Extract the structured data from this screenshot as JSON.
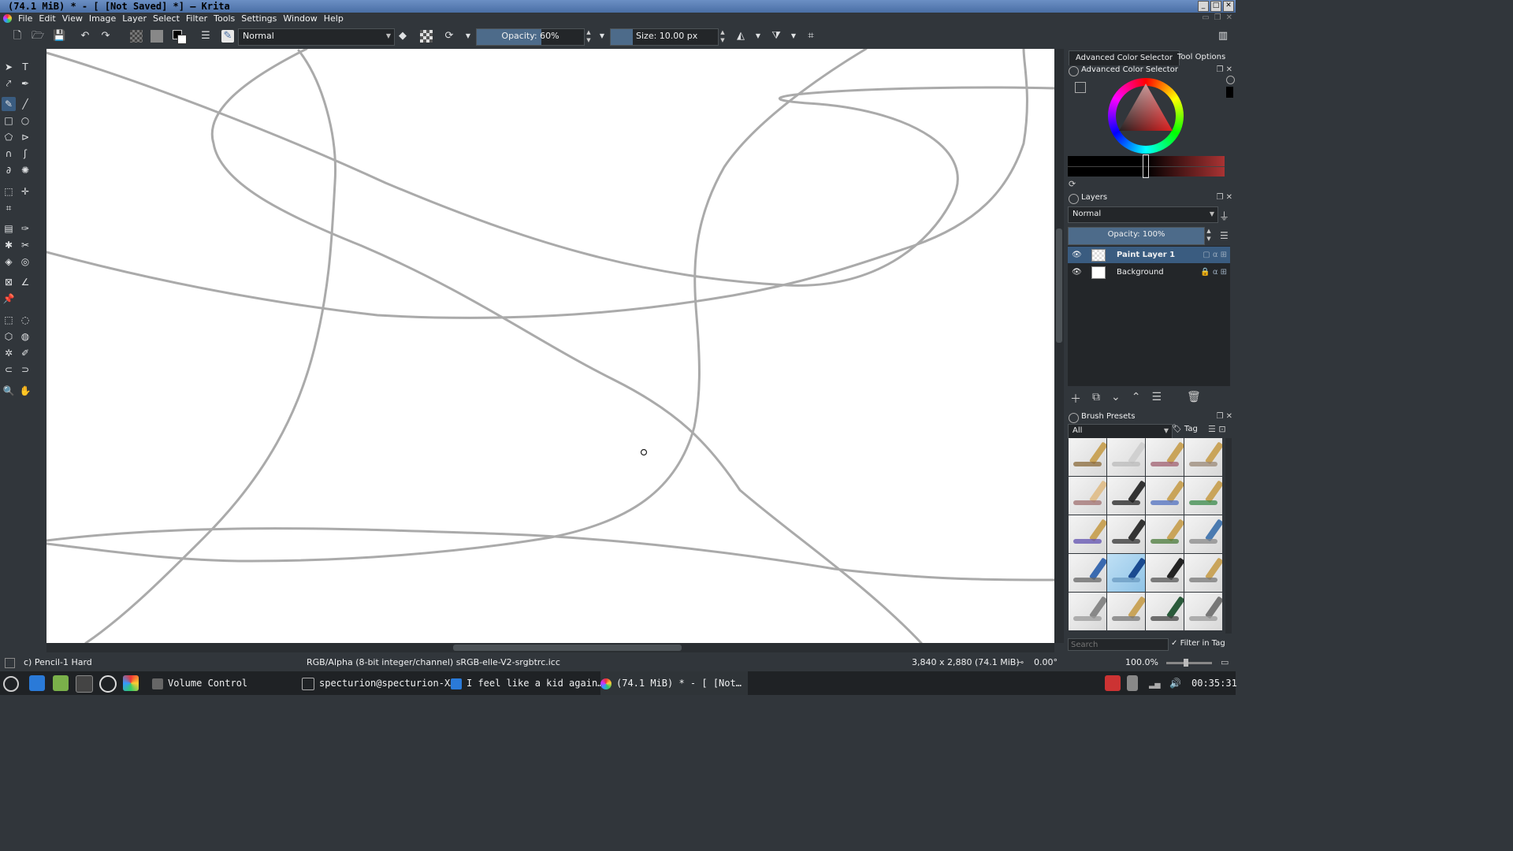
{
  "window": {
    "title": "(74.1 MiB)  * - [ [Not Saved]  *] – Krita",
    "controls": [
      "_",
      "□",
      "✕"
    ]
  },
  "menubar": {
    "items": [
      "File",
      "Edit",
      "View",
      "Image",
      "Layer",
      "Select",
      "Filter",
      "Tools",
      "Settings",
      "Window",
      "Help"
    ]
  },
  "toolbar": {
    "blend_mode": "Normal",
    "opacity_label": "Opacity: 60%",
    "opacity_value": 0.6,
    "size_label": "Size: 10.00 px",
    "colors": {
      "foreground": "#000000",
      "background": "#ffffff",
      "accent": "#4d6b8a"
    }
  },
  "toolbox": {
    "active_tool": "freehand-brush-tool"
  },
  "dock": {
    "tabs": [
      "Advanced Color Selector",
      "Tool Options"
    ],
    "color_selector": {
      "title": "Advanced Color Selector"
    },
    "layers": {
      "title": "Layers",
      "blend_mode": "Normal",
      "opacity_label": "Opacity:  100%",
      "items": [
        {
          "name": "Paint Layer 1",
          "selected": true
        },
        {
          "name": "Background",
          "selected": false
        }
      ]
    },
    "brush_presets": {
      "title": "Brush Presets",
      "filter": "All",
      "tag_label": "Tag",
      "search_placeholder": "Search",
      "filter_in_tag_label": "Filter in Tag"
    }
  },
  "statusbar": {
    "brush_name": "c) Pencil-1 Hard",
    "color_space": "RGB/Alpha (8-bit integer/channel)  sRGB-elle-V2-srgbtrc.icc",
    "image_size": "3,840 x 2,880 (74.1 MiB)",
    "rotation": "0.00°",
    "zoom": "100.0%"
  },
  "taskbar": {
    "tasks": [
      {
        "label": "Volume Control"
      },
      {
        "label": "specturion@specturion-X…"
      },
      {
        "label": "I feel like a kid again…"
      },
      {
        "label": "(74.1 MiB)  * - [ [Not…"
      }
    ],
    "clock": "00:35:31"
  }
}
